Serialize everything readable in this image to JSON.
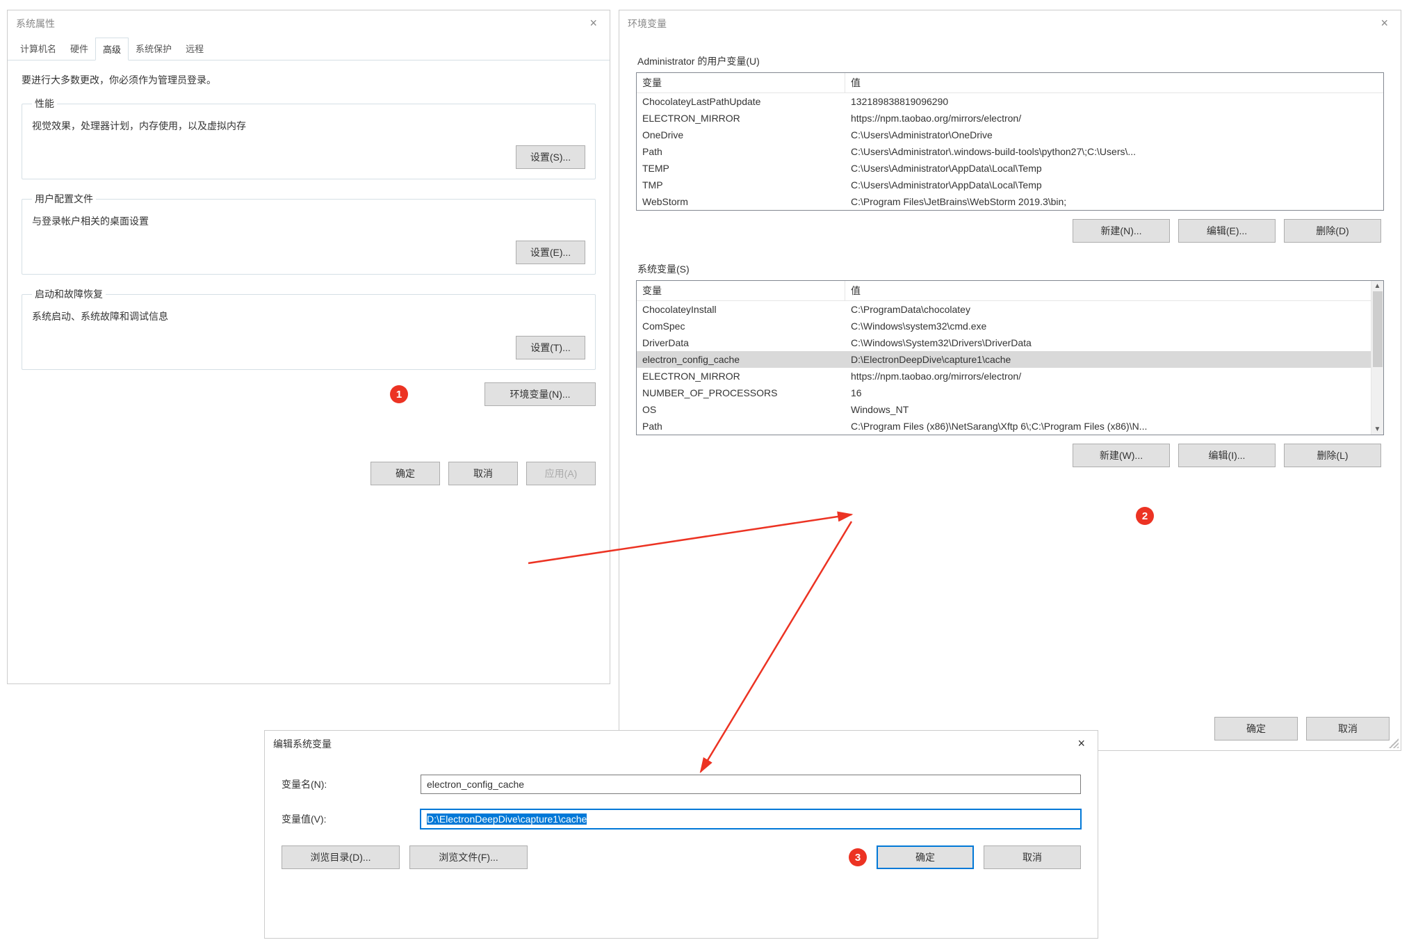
{
  "sysprops": {
    "title": "系统属性",
    "tabs": [
      "计算机名",
      "硬件",
      "高级",
      "系统保护",
      "远程"
    ],
    "active_tab": 2,
    "admin_note": "要进行大多数更改，你必须作为管理员登录。",
    "groups": {
      "perf": {
        "legend": "性能",
        "desc": "视觉效果，处理器计划，内存使用，以及虚拟内存",
        "btn": "设置(S)..."
      },
      "profile": {
        "legend": "用户配置文件",
        "desc": "与登录帐户相关的桌面设置",
        "btn": "设置(E)..."
      },
      "startup": {
        "legend": "启动和故障恢复",
        "desc": "系统启动、系统故障和调试信息",
        "btn": "设置(T)..."
      }
    },
    "env_btn": "环境变量(N)...",
    "footer": {
      "ok": "确定",
      "cancel": "取消",
      "apply": "应用(A)"
    }
  },
  "envvars": {
    "title": "环境变量",
    "user_section": "Administrator 的用户变量(U)",
    "col_var": "变量",
    "col_val": "值",
    "user_rows": [
      {
        "name": "ChocolateyLastPathUpdate",
        "value": "132189838819096290"
      },
      {
        "name": "ELECTRON_MIRROR",
        "value": "https://npm.taobao.org/mirrors/electron/"
      },
      {
        "name": "OneDrive",
        "value": "C:\\Users\\Administrator\\OneDrive"
      },
      {
        "name": "Path",
        "value": "C:\\Users\\Administrator\\.windows-build-tools\\python27\\;C:\\Users\\..."
      },
      {
        "name": "TEMP",
        "value": "C:\\Users\\Administrator\\AppData\\Local\\Temp"
      },
      {
        "name": "TMP",
        "value": "C:\\Users\\Administrator\\AppData\\Local\\Temp"
      },
      {
        "name": "WebStorm",
        "value": "C:\\Program Files\\JetBrains\\WebStorm 2019.3\\bin;"
      }
    ],
    "user_buttons": {
      "new": "新建(N)...",
      "edit": "编辑(E)...",
      "del": "删除(D)"
    },
    "sys_section": "系统变量(S)",
    "sys_rows": [
      {
        "name": "ChocolateyInstall",
        "value": "C:\\ProgramData\\chocolatey"
      },
      {
        "name": "ComSpec",
        "value": "C:\\Windows\\system32\\cmd.exe"
      },
      {
        "name": "DriverData",
        "value": "C:\\Windows\\System32\\Drivers\\DriverData"
      },
      {
        "name": "electron_config_cache",
        "value": "D:\\ElectronDeepDive\\capture1\\cache"
      },
      {
        "name": "ELECTRON_MIRROR",
        "value": "https://npm.taobao.org/mirrors/electron/"
      },
      {
        "name": "NUMBER_OF_PROCESSORS",
        "value": "16"
      },
      {
        "name": "OS",
        "value": "Windows_NT"
      },
      {
        "name": "Path",
        "value": "C:\\Program Files (x86)\\NetSarang\\Xftp 6\\;C:\\Program Files (x86)\\N..."
      }
    ],
    "sys_selected_index": 3,
    "sys_buttons": {
      "new": "新建(W)...",
      "edit": "编辑(I)...",
      "del": "删除(L)"
    },
    "footer": {
      "ok": "确定",
      "cancel": "取消"
    }
  },
  "editvar": {
    "title": "编辑系统变量",
    "name_label": "变量名(N):",
    "name_value": "electron_config_cache",
    "value_label": "变量值(V):",
    "value_value": "D:\\ElectronDeepDive\\capture1\\cache",
    "browse_dir": "浏览目录(D)...",
    "browse_file": "浏览文件(F)...",
    "ok": "确定",
    "cancel": "取消"
  },
  "callouts": {
    "c1": "1",
    "c2": "2",
    "c3": "3"
  }
}
